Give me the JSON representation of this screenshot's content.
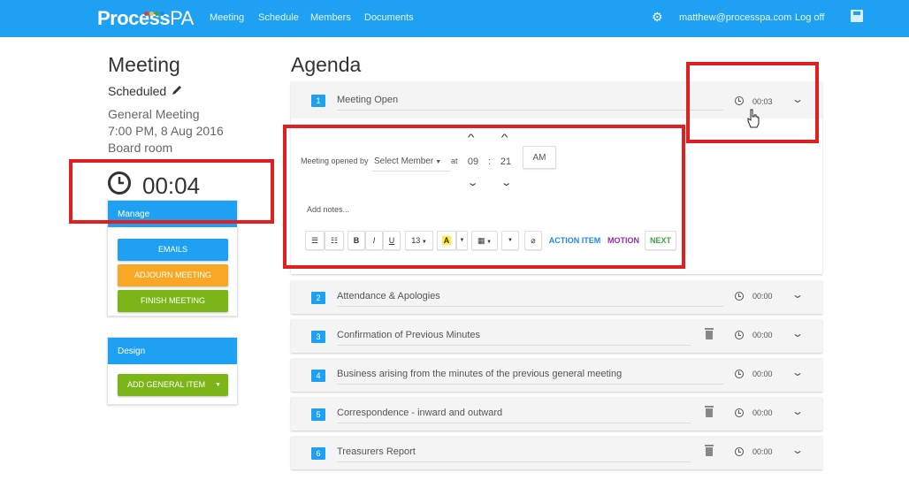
{
  "app": {
    "brand": "Process",
    "brand_suffix": "PA",
    "brand_dot_colors": [
      "#e53935",
      "#fbc02d",
      "#43a047",
      "#1e88e5"
    ],
    "nav": [
      "Meeting",
      "Schedule",
      "Members",
      "Documents"
    ],
    "user_email": "matthew@processpa.com",
    "logoff": "Log off"
  },
  "meeting": {
    "heading": "Meeting",
    "status": "Scheduled",
    "type": "General Meeting",
    "datetime": "7:00 PM, 8 Aug 2016",
    "location": "Board room",
    "elapsed": "00:04"
  },
  "manage_panel": {
    "title": "Manage",
    "emails": "EMAILS",
    "adjourn": "ADJOURN MEETING",
    "finish": "FINISH MEETING"
  },
  "design_panel": {
    "title": "Design",
    "add_item": "ADD GENERAL ITEM"
  },
  "agenda": {
    "heading": "Agenda",
    "items": [
      {
        "number": "1",
        "title": "Meeting Open",
        "time": "00:03",
        "deletable": false
      },
      {
        "number": "2",
        "title": "Attendance & Apologies",
        "time": "00:00",
        "deletable": false
      },
      {
        "number": "3",
        "title": "Confirmation of Previous Minutes",
        "time": "00:00",
        "deletable": true
      },
      {
        "number": "4",
        "title": "Business arising from the minutes of the previous general meeting",
        "time": "00:00",
        "deletable": false
      },
      {
        "number": "5",
        "title": "Correspondence - inward and outward",
        "time": "00:00",
        "deletable": true
      },
      {
        "number": "6",
        "title": "Treasurers Report",
        "time": "00:00",
        "deletable": true
      }
    ]
  },
  "editor": {
    "opened_by_label": "Meeting opened by",
    "member_select": "Select Member",
    "at_label": "at",
    "hour": "09",
    "colon": ":",
    "minute": "21",
    "ampm": "AM",
    "notes_placeholder": "Add notes...",
    "toolbar": {
      "bold": "B",
      "italic": "I",
      "underline": "U",
      "font_size": "13",
      "font_color": "A",
      "action_item": "ACTION ITEM",
      "motion": "MOTION",
      "next": "NEXT"
    }
  },
  "colors": {
    "primary": "#1ea1f2",
    "adjourn": "#f9a825",
    "finish": "#7cb518",
    "action_item": "#1e88e5",
    "motion": "#9c27b0",
    "next": "#43a047",
    "annotation": "#e02020"
  }
}
